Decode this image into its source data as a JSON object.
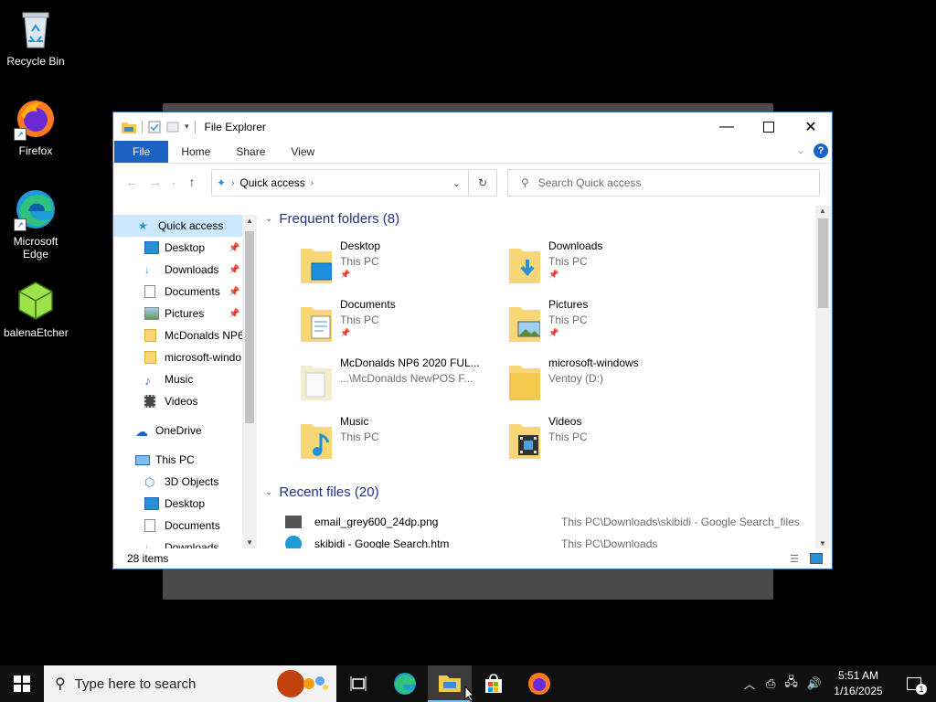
{
  "desktop": {
    "icons": [
      {
        "label": "Recycle Bin"
      },
      {
        "label": "Firefox"
      },
      {
        "label": "Microsoft Edge"
      },
      {
        "label": "balenaEtcher"
      }
    ]
  },
  "window": {
    "title": "File Explorer",
    "ribbon_tabs": [
      "File",
      "Home",
      "Share",
      "View"
    ],
    "address": {
      "crumb": "Quick access"
    },
    "search_placeholder": "Search Quick access",
    "status": "28 items"
  },
  "navpane": {
    "items": [
      {
        "label": "Quick access",
        "icon": "star-icon",
        "selected": true
      },
      {
        "label": "Desktop",
        "icon": "desktop-folder-icon",
        "pinned": true
      },
      {
        "label": "Downloads",
        "icon": "download-arrow-icon",
        "pinned": true
      },
      {
        "label": "Documents",
        "icon": "document-icon",
        "pinned": true
      },
      {
        "label": "Pictures",
        "icon": "picture-icon",
        "pinned": true
      },
      {
        "label": "McDonalds NP6",
        "icon": "folder-icon"
      },
      {
        "label": "microsoft-windo",
        "icon": "folder-icon"
      },
      {
        "label": "Music",
        "icon": "music-note-icon"
      },
      {
        "label": "Videos",
        "icon": "film-icon"
      },
      {
        "label": "OneDrive",
        "icon": "cloud-icon"
      },
      {
        "label": "This PC",
        "icon": "computer-icon"
      },
      {
        "label": "3D Objects",
        "icon": "cube-icon"
      },
      {
        "label": "Desktop",
        "icon": "desktop-folder-icon"
      },
      {
        "label": "Documents",
        "icon": "document-icon"
      },
      {
        "label": "Downloads",
        "icon": "download-arrow-icon"
      }
    ]
  },
  "content": {
    "frequent_header": "Frequent folders (8)",
    "frequent": [
      {
        "name": "Desktop",
        "location": "This PC",
        "pinned": true,
        "icon": "desktop-folder-icon"
      },
      {
        "name": "Downloads",
        "location": "This PC",
        "pinned": true,
        "icon": "downloads-folder-icon"
      },
      {
        "name": "Documents",
        "location": "This PC",
        "pinned": true,
        "icon": "documents-folder-icon"
      },
      {
        "name": "Pictures",
        "location": "This PC",
        "pinned": true,
        "icon": "pictures-folder-icon"
      },
      {
        "name": "McDonalds NP6 2020 FUL...",
        "location": "...\\McDonalds NewPOS F...",
        "pinned": false,
        "icon": "folder-icon"
      },
      {
        "name": "microsoft-windows",
        "location": "Ventoy (D:)",
        "pinned": false,
        "icon": "folder-icon"
      },
      {
        "name": "Music",
        "location": "This PC",
        "pinned": false,
        "icon": "music-folder-icon"
      },
      {
        "name": "Videos",
        "location": "This PC",
        "pinned": false,
        "icon": "videos-folder-icon"
      }
    ],
    "recent_header": "Recent files (20)",
    "recent": [
      {
        "name": "email_grey600_24dp.png",
        "path": "This PC\\Downloads\\skibidi - Google Search_files",
        "icon": "envelope-icon"
      },
      {
        "name": "skibidi - Google Search.htm",
        "path": "This PC\\Downloads",
        "icon": "edge-icon"
      }
    ]
  },
  "taskbar": {
    "search_placeholder": "Type here to search",
    "time": "5:51 AM",
    "date": "1/16/2025",
    "notification_count": "1"
  }
}
